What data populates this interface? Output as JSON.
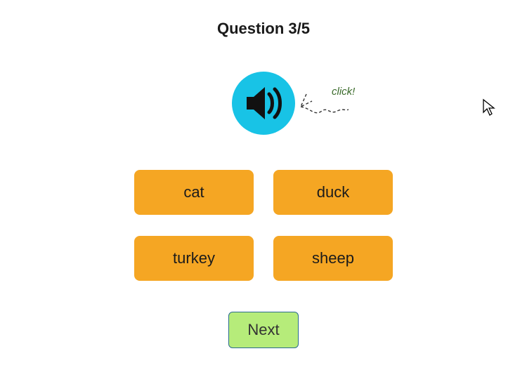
{
  "title": "Question 3/5",
  "audio": {
    "hint": "click!"
  },
  "options": [
    "cat",
    "duck",
    "turkey",
    "sheep"
  ],
  "next_label": "Next",
  "colors": {
    "audio_bg": "#18c3e6",
    "option_bg": "#f5a623",
    "next_bg": "#b6ec7a"
  }
}
